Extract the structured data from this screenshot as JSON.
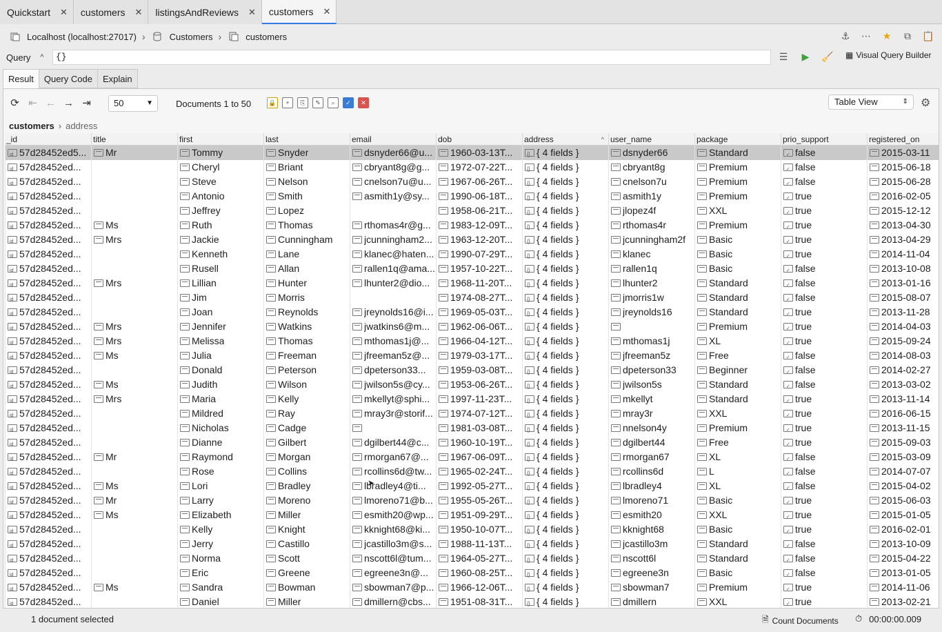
{
  "tabs": [
    {
      "label": "Quickstart",
      "active": false
    },
    {
      "label": "customers",
      "active": false
    },
    {
      "label": "listingsAndReviews",
      "active": false
    },
    {
      "label": "customers",
      "active": true
    }
  ],
  "breadcrumb": {
    "connection": "Localhost (localhost:27017)",
    "database": "Customers",
    "collection": "customers"
  },
  "query": {
    "label": "Query",
    "value": "{}",
    "visual_query_builder": "Visual Query Builder"
  },
  "result_tabs": [
    "Result",
    "Query Code",
    "Explain"
  ],
  "toolbar": {
    "page_size": "50",
    "doc_count": "Documents 1 to 50",
    "view_mode": "Table View"
  },
  "path": {
    "root": "customers",
    "leaf": "address"
  },
  "columns": [
    "_id",
    "title",
    "first",
    "last",
    "email",
    "dob",
    "address",
    "user_name",
    "package",
    "prio_support",
    "registered_on"
  ],
  "rows": [
    [
      "57d28452ed5...",
      "Mr",
      "Tommy",
      "Snyder",
      "dsnyder66@u...",
      "1960-03-13T...",
      "{ 4 fields }",
      "dsnyder66",
      "Standard",
      "false",
      "2015-03-11"
    ],
    [
      "57d28452ed...",
      "",
      "Cheryl",
      "Briant",
      "cbryant8g@g...",
      "1972-07-22T...",
      "{ 4 fields }",
      "cbryant8g",
      "Premium",
      "false",
      "2015-06-18"
    ],
    [
      "57d28452ed...",
      "",
      "Steve",
      "Nelson",
      "cnelson7u@u...",
      "1967-06-26T...",
      "{ 4 fields }",
      "cnelson7u",
      "Premium",
      "false",
      "2015-06-28"
    ],
    [
      "57d28452ed...",
      "",
      "Antonio",
      "Smith",
      "asmith1y@sy...",
      "1990-06-18T...",
      "{ 4 fields }",
      "asmith1y",
      "Premium",
      "true",
      "2016-02-05"
    ],
    [
      "57d28452ed...",
      "",
      "Jeffrey",
      "Lopez",
      "",
      "1958-06-21T...",
      "{ 4 fields }",
      "jlopez4f",
      "XXL",
      "true",
      "2015-12-12"
    ],
    [
      "57d28452ed...",
      "Ms",
      "Ruth",
      "Thomas",
      "rthomas4r@g...",
      "1983-12-09T...",
      "{ 4 fields }",
      "rthomas4r",
      "Premium",
      "true",
      "2013-04-30"
    ],
    [
      "57d28452ed...",
      "Mrs",
      "Jackie",
      "Cunningham",
      "jcunningham2...",
      "1963-12-20T...",
      "{ 4 fields }",
      "jcunningham2f",
      "Basic",
      "true",
      "2013-04-29"
    ],
    [
      "57d28452ed...",
      "",
      "Kenneth",
      "Lane",
      "klanec@haten...",
      "1990-07-29T...",
      "{ 4 fields }",
      "klanec",
      "Basic",
      "true",
      "2014-11-04"
    ],
    [
      "57d28452ed...",
      "",
      "Rusell",
      "Allan",
      "rallen1q@ama...",
      "1957-10-22T...",
      "{ 4 fields }",
      "rallen1q",
      "Basic",
      "false",
      "2013-10-08"
    ],
    [
      "57d28452ed...",
      "Mrs",
      "Lillian",
      "Hunter",
      "lhunter2@dio...",
      "1968-11-20T...",
      "{ 4 fields }",
      "lhunter2",
      "Standard",
      "false",
      "2013-01-16"
    ],
    [
      "57d28452ed...",
      "",
      "Jim",
      "Morris",
      "",
      "1974-08-27T...",
      "{ 4 fields }",
      "jmorris1w",
      "Standard",
      "false",
      "2015-08-07"
    ],
    [
      "57d28452ed...",
      "",
      "Joan",
      "Reynolds",
      "jreynolds16@i...",
      "1969-05-03T...",
      "{ 4 fields }",
      "jreynolds16",
      "Standard",
      "true",
      "2013-11-28"
    ],
    [
      "57d28452ed...",
      "Mrs",
      "Jennifer",
      "Watkins",
      "jwatkins6@m...",
      "1962-06-06T...",
      "{ 4 fields }",
      "",
      "Premium",
      "true",
      "2014-04-03"
    ],
    [
      "57d28452ed...",
      "Mrs",
      "Melissa",
      "Thomas",
      "mthomas1j@...",
      "1966-04-12T...",
      "{ 4 fields }",
      "mthomas1j",
      "XL",
      "true",
      "2015-09-24"
    ],
    [
      "57d28452ed...",
      "Ms",
      "Julia",
      "Freeman",
      "jfreeman5z@...",
      "1979-03-17T...",
      "{ 4 fields }",
      "jfreeman5z",
      "Free",
      "false",
      "2014-08-03"
    ],
    [
      "57d28452ed...",
      "",
      "Donald",
      "Peterson",
      "dpeterson33...",
      "1959-03-08T...",
      "{ 4 fields }",
      "dpeterson33",
      "Beginner",
      "false",
      "2014-02-27"
    ],
    [
      "57d28452ed...",
      "Ms",
      "Judith",
      "Wilson",
      "jwilson5s@cy...",
      "1953-06-26T...",
      "{ 4 fields }",
      "jwilson5s",
      "Standard",
      "false",
      "2013-03-02"
    ],
    [
      "57d28452ed...",
      "Mrs",
      "Maria",
      "Kelly",
      "mkellyt@sphi...",
      "1997-11-23T...",
      "{ 4 fields }",
      "mkellyt",
      "Standard",
      "true",
      "2013-11-14"
    ],
    [
      "57d28452ed...",
      "",
      "Mildred",
      "Ray",
      "mray3r@storif...",
      "1974-07-12T...",
      "{ 4 fields }",
      "mray3r",
      "XXL",
      "true",
      "2016-06-15"
    ],
    [
      "57d28452ed...",
      "",
      "Nicholas",
      "Cadge",
      "",
      "1981-03-08T...",
      "{ 4 fields }",
      "nnelson4y",
      "Premium",
      "true",
      "2013-11-15"
    ],
    [
      "57d28452ed...",
      "",
      "Dianne",
      "Gilbert",
      "dgilbert44@c...",
      "1960-10-19T...",
      "{ 4 fields }",
      "dgilbert44",
      "Free",
      "true",
      "2015-09-03"
    ],
    [
      "57d28452ed...",
      "Mr",
      "Raymond",
      "Morgan",
      "rmorgan67@...",
      "1967-06-09T...",
      "{ 4 fields }",
      "rmorgan67",
      "XL",
      "false",
      "2015-03-09"
    ],
    [
      "57d28452ed...",
      "",
      "Rose",
      "Collins",
      "rcollins6d@tw...",
      "1965-02-24T...",
      "{ 4 fields }",
      "rcollins6d",
      "L",
      "false",
      "2014-07-07"
    ],
    [
      "57d28452ed...",
      "Ms",
      "Lori",
      "Bradley",
      "lbradley4@ti...",
      "1992-05-27T...",
      "{ 4 fields }",
      "lbradley4",
      "XL",
      "false",
      "2015-04-02"
    ],
    [
      "57d28452ed...",
      "Mr",
      "Larry",
      "Moreno",
      "lmoreno71@b...",
      "1955-05-26T...",
      "{ 4 fields }",
      "lmoreno71",
      "Basic",
      "true",
      "2015-06-03"
    ],
    [
      "57d28452ed...",
      "Ms",
      "Elizabeth",
      "Miller",
      "esmith20@wp...",
      "1951-09-29T...",
      "{ 4 fields }",
      "esmith20",
      "XXL",
      "true",
      "2015-01-05"
    ],
    [
      "57d28452ed...",
      "",
      "Kelly",
      "Knight",
      "kknight68@ki...",
      "1950-10-07T...",
      "{ 4 fields }",
      "kknight68",
      "Basic",
      "true",
      "2016-02-01"
    ],
    [
      "57d28452ed...",
      "",
      "Jerry",
      "Castillo",
      "jcastillo3m@s...",
      "1988-11-13T...",
      "{ 4 fields }",
      "jcastillo3m",
      "Standard",
      "false",
      "2013-10-09"
    ],
    [
      "57d28452ed...",
      "",
      "Norma",
      "Scott",
      "nscott6l@tum...",
      "1964-05-27T...",
      "{ 4 fields }",
      "nscott6l",
      "Standard",
      "false",
      "2015-04-22"
    ],
    [
      "57d28452ed...",
      "",
      "Eric",
      "Greene",
      "egreene3n@...",
      "1960-08-25T...",
      "{ 4 fields }",
      "egreene3n",
      "Basic",
      "false",
      "2013-01-05"
    ],
    [
      "57d28452ed...",
      "Ms",
      "Sandra",
      "Bowman",
      "sbowman7@p...",
      "1966-12-06T...",
      "{ 4 fields }",
      "sbowman7",
      "Premium",
      "true",
      "2014-11-06"
    ],
    [
      "57d28452ed...",
      "",
      "Daniel",
      "Miller",
      "dmillern@cbs...",
      "1951-08-31T...",
      "{ 4 fields }",
      "dmillern",
      "XXL",
      "true",
      "2013-02-21"
    ]
  ],
  "status": {
    "selection": "1 document selected",
    "count_documents": "Count Documents",
    "elapsed": "00:00:00.009"
  }
}
